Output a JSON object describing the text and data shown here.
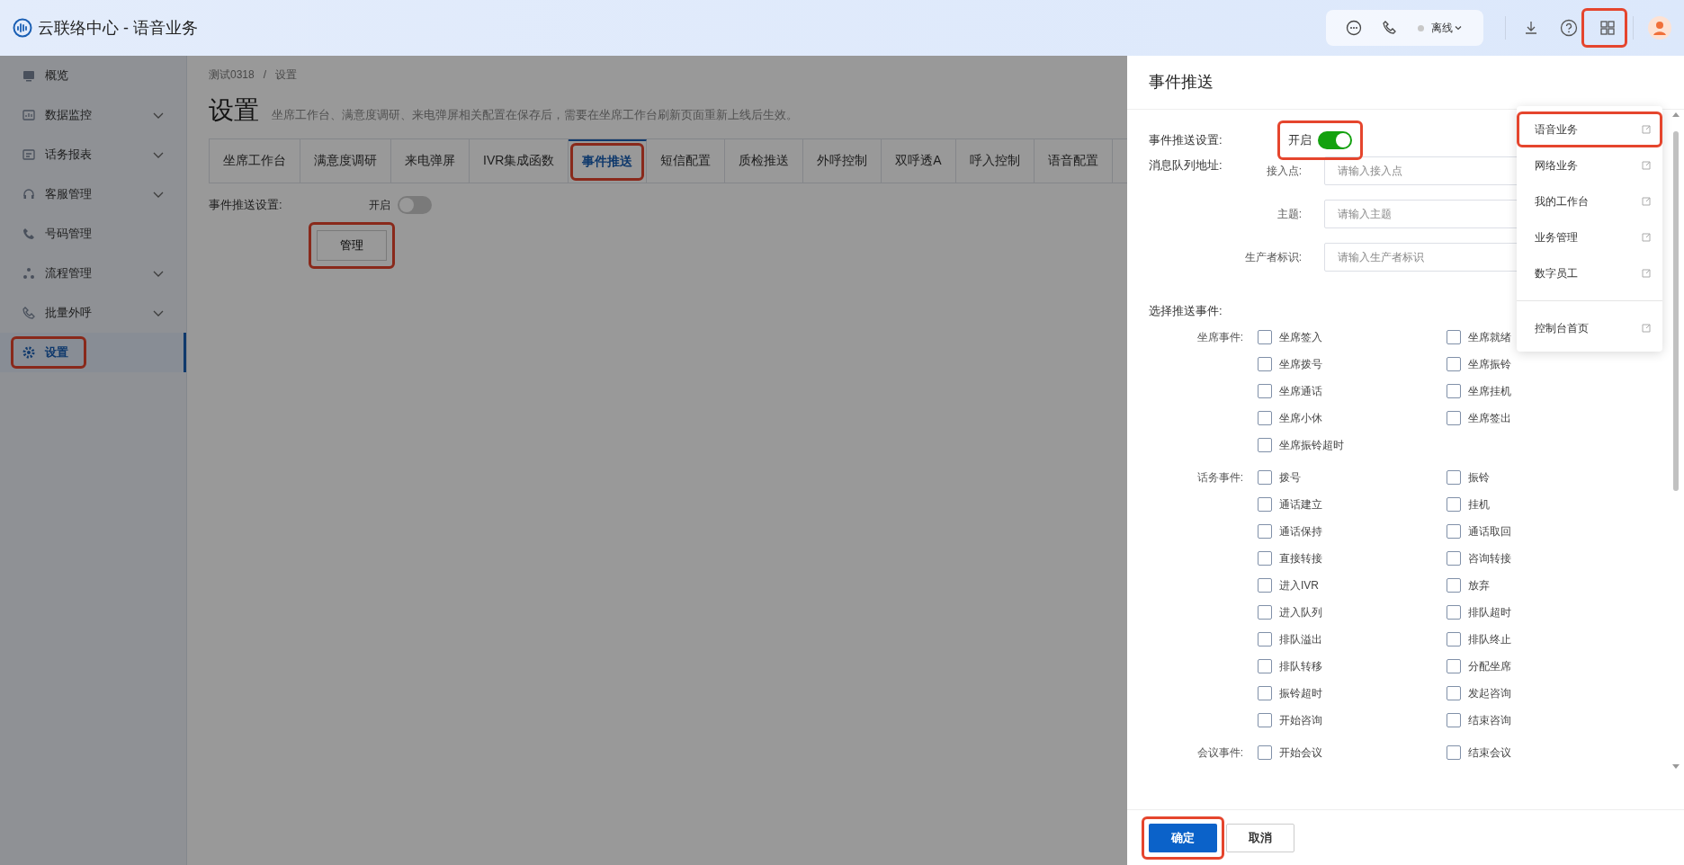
{
  "app": {
    "title": "云联络中心 - 语音业务"
  },
  "toolbar": {
    "status": {
      "label": "离线",
      "online": false
    },
    "apps_button": {
      "highlighted": true
    }
  },
  "sidebar": {
    "items": [
      {
        "label": "概览",
        "expandable": false,
        "selected": false,
        "highlighted": false
      },
      {
        "label": "数据监控",
        "expandable": true,
        "selected": false,
        "highlighted": false
      },
      {
        "label": "话务报表",
        "expandable": true,
        "selected": false,
        "highlighted": false
      },
      {
        "label": "客服管理",
        "expandable": true,
        "selected": false,
        "highlighted": false
      },
      {
        "label": "号码管理",
        "expandable": false,
        "selected": false,
        "highlighted": false
      },
      {
        "label": "流程管理",
        "expandable": true,
        "selected": false,
        "highlighted": false
      },
      {
        "label": "批量外呼",
        "expandable": true,
        "selected": false,
        "highlighted": false
      },
      {
        "label": "设置",
        "expandable": false,
        "selected": true,
        "highlighted": true
      }
    ]
  },
  "breadcrumb": {
    "items": [
      "测试0318",
      "设置"
    ],
    "separator": "/"
  },
  "page": {
    "title": "设置",
    "note": "坐席工作台、满意度调研、来电弹屏相关配置在保存后，需要在坐席工作台刷新页面重新上线后生效。"
  },
  "tabs": [
    {
      "label": "坐席工作台",
      "selected": false,
      "highlighted": false
    },
    {
      "label": "满意度调研",
      "selected": false,
      "highlighted": false
    },
    {
      "label": "来电弹屏",
      "selected": false,
      "highlighted": false
    },
    {
      "label": "IVR集成函数",
      "selected": false,
      "highlighted": false
    },
    {
      "label": "事件推送",
      "selected": true,
      "highlighted": true
    },
    {
      "label": "短信配置",
      "selected": false,
      "highlighted": false
    },
    {
      "label": "质检推送",
      "selected": false,
      "highlighted": false
    },
    {
      "label": "外呼控制",
      "selected": false,
      "highlighted": false
    },
    {
      "label": "双呼透A",
      "selected": false,
      "highlighted": false
    },
    {
      "label": "呼入控制",
      "selected": false,
      "highlighted": false
    },
    {
      "label": "语音配置",
      "selected": false,
      "highlighted": false
    }
  ],
  "settings": {
    "label": "事件推送设置:",
    "switch_label": "开启",
    "on": false,
    "manage_button": {
      "label": "管理",
      "highlighted": true
    }
  },
  "drawer": {
    "title": "事件推送",
    "push_setting": {
      "label": "事件推送设置:",
      "switch_label": "开启",
      "on": true,
      "highlighted": true
    },
    "queue_label": "消息队列地址:",
    "fields": [
      {
        "label": "接入点:",
        "placeholder": "请输入接入点"
      },
      {
        "label": "主题:",
        "placeholder": "请输入主题"
      },
      {
        "label": "生产者标识:",
        "placeholder": "请输入生产者标识"
      }
    ],
    "events_label": "选择推送事件:",
    "groups": [
      {
        "label": "坐席事件:",
        "events": [
          {
            "label": "坐席签入",
            "checked": false
          },
          {
            "label": "坐席就绪",
            "checked": false
          },
          {
            "label": "坐席拨号",
            "checked": false
          },
          {
            "label": "坐席振铃",
            "checked": false
          },
          {
            "label": "坐席通话",
            "checked": false
          },
          {
            "label": "坐席挂机",
            "checked": false
          },
          {
            "label": "坐席小休",
            "checked": false
          },
          {
            "label": "坐席签出",
            "checked": false
          },
          {
            "label": "坐席振铃超时",
            "checked": false
          }
        ]
      },
      {
        "label": "话务事件:",
        "events": [
          {
            "label": "拨号",
            "checked": false
          },
          {
            "label": "振铃",
            "checked": false
          },
          {
            "label": "通话建立",
            "checked": false
          },
          {
            "label": "挂机",
            "checked": false
          },
          {
            "label": "通话保持",
            "checked": false
          },
          {
            "label": "通话取回",
            "checked": false
          },
          {
            "label": "直接转接",
            "checked": false
          },
          {
            "label": "咨询转接",
            "checked": false
          },
          {
            "label": "进入IVR",
            "checked": false
          },
          {
            "label": "放弃",
            "checked": false
          },
          {
            "label": "进入队列",
            "checked": false
          },
          {
            "label": "排队超时",
            "checked": false
          },
          {
            "label": "排队溢出",
            "checked": false
          },
          {
            "label": "排队终止",
            "checked": false
          },
          {
            "label": "排队转移",
            "checked": false
          },
          {
            "label": "分配坐席",
            "checked": false
          },
          {
            "label": "振铃超时",
            "checked": false
          },
          {
            "label": "发起咨询",
            "checked": false
          },
          {
            "label": "开始咨询",
            "checked": false
          },
          {
            "label": "结束咨询",
            "checked": false
          }
        ]
      },
      {
        "label": "会议事件:",
        "events": [
          {
            "label": "开始会议",
            "checked": false
          },
          {
            "label": "结束会议",
            "checked": false
          }
        ]
      }
    ],
    "buttons": [
      {
        "label": "确定",
        "kind": "primary",
        "highlighted": true
      },
      {
        "label": "取消",
        "kind": "secondary",
        "highlighted": false
      }
    ]
  },
  "app_menu": {
    "items": [
      {
        "label": "语音业务",
        "highlighted": true
      },
      {
        "label": "网络业务",
        "highlighted": false
      },
      {
        "label": "我的工作台",
        "highlighted": false
      },
      {
        "label": "业务管理",
        "highlighted": false
      },
      {
        "label": "数字员工",
        "highlighted": false
      }
    ],
    "footer_item": {
      "label": "控制台首页"
    }
  }
}
